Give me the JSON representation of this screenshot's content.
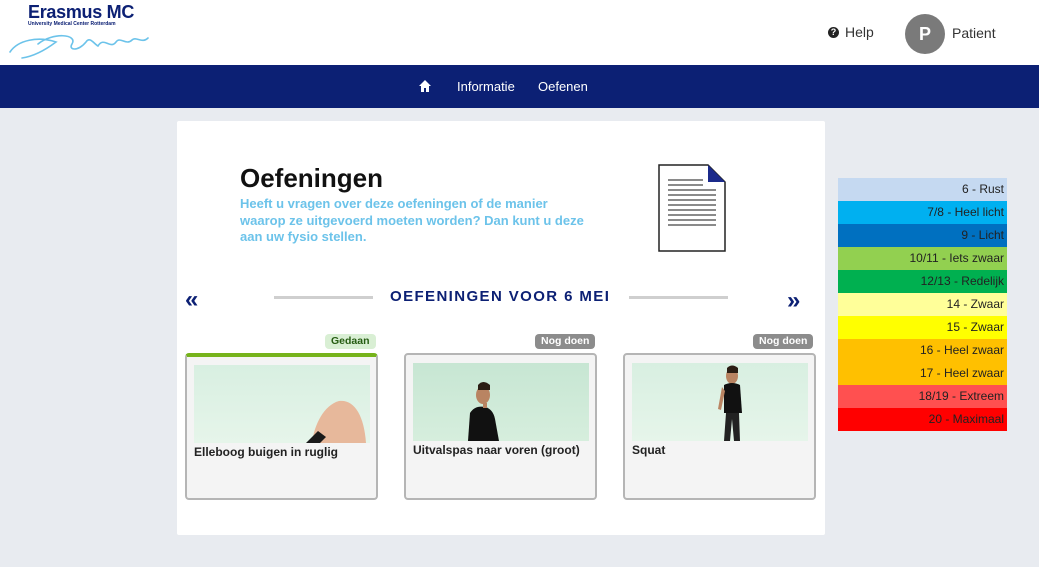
{
  "header": {
    "logo_brand": "Erasmus MC",
    "logo_sub": "University Medical Center Rotterdam",
    "help_label": "Help",
    "avatar_initial": "P",
    "user_name": "Patient"
  },
  "nav": {
    "items": [
      {
        "label": "Informatie"
      },
      {
        "label": "Oefenen"
      }
    ]
  },
  "main": {
    "title": "Oefeningen",
    "intro": "Heeft u vragen over deze oefeningen of de manier waarop ze uitgevoerd moeten worden? Dan kunt u deze aan uw fysio stellen.",
    "prev_arrow": "«",
    "next_arrow": "»",
    "day_heading": "OEFENINGEN VOOR 6 MEI",
    "exercises": [
      {
        "label": "Elleboog buigen in ruglig",
        "status": "Gedaan",
        "status_color": "#d9efd4"
      },
      {
        "label": "Uitvalspas naar voren (groot)",
        "status": "Nog doen",
        "status_color": "#8c8c8c"
      },
      {
        "label": "Squat",
        "status": "Nog doen",
        "status_color": "#8c8c8c"
      }
    ]
  },
  "borg_scale": [
    {
      "label": "6 - Rust",
      "color": "#c5d9f1"
    },
    {
      "label": "7/8 - Heel licht",
      "color": "#00b0f0"
    },
    {
      "label": "9 - Licht",
      "color": "#0070c0"
    },
    {
      "label": "10/11 - Iets zwaar",
      "color": "#92d050"
    },
    {
      "label": "12/13 - Redelijk",
      "color": "#00b050"
    },
    {
      "label": "14 - Zwaar",
      "color": "#ffff99"
    },
    {
      "label": "15 - Zwaar",
      "color": "#ffff00"
    },
    {
      "label": "16 - Heel zwaar",
      "color": "#ffc000"
    },
    {
      "label": "17 - Heel zwaar",
      "color": "#ffc000"
    },
    {
      "label": "18/19 - Extreem",
      "color": "#ff5050"
    },
    {
      "label": "20 - Maximaal",
      "color": "#ff0000"
    }
  ]
}
